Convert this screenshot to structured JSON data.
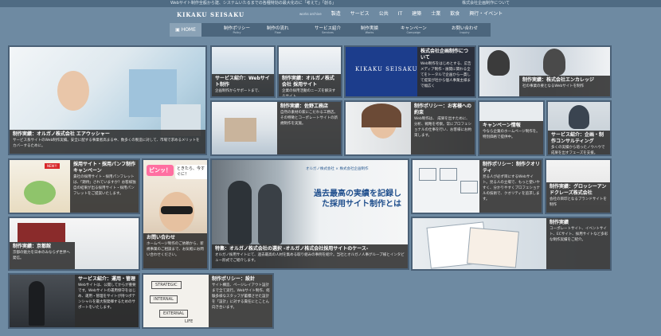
{
  "topbar": {
    "tagline": "Webサイト制作全般から建、システムいたるまでの各種特効の最大化のに「考えて」「創る」",
    "right": "株式会社企画制作について"
  },
  "logo": "KIKAKU SEISAKU",
  "topnav": {
    "small": "works archive",
    "items": [
      "製造",
      "サービス",
      "公共",
      "IT",
      "建築",
      "士業",
      "飲食",
      "興行・イベント"
    ]
  },
  "subnav": {
    "home": "HOME",
    "items": [
      {
        "label": "制作ポリシー",
        "sub": "Policy"
      },
      {
        "label": "制作の流れ",
        "sub": "Flow"
      },
      {
        "label": "サービス紹介",
        "sub": "Services"
      },
      {
        "label": "制作実績",
        "sub": "Works"
      },
      {
        "label": "キャンペーン",
        "sub": "Campaign"
      },
      {
        "label": "お問い合わせ",
        "sub": "Inquiry"
      }
    ]
  },
  "tiles": {
    "t1": {
      "title": "制作実績：オルガノ株式会社 エアウッシャー",
      "desc": "サービス系サイトのWeb制作実績。安全に配する事業者高まる中、数多くの製造に対して、市場で求めるメリットをカバーするために。"
    },
    "t2": {
      "title": "サービス紹介：Webサイト制作",
      "desc": "企画制作からサポートまで、"
    },
    "t3": {
      "title": "制作実績：オルガノ株式会社 採用サイト",
      "desc": "企業の採用活動のニーズを解決するサイト"
    },
    "t4": {
      "logo": "KIKAKU SEISAKU",
      "title": "株式会社企画制作について",
      "desc": "Web制作をはじめとする、広告メディア制作・展開に関わる全てをトータルで企画から一貫して提案が社から個人事業主様まで幅広く"
    },
    "t5": {
      "title": "制作実績：株式会社エンカレッジ",
      "desc": "社の事業の要となるWebサイトを制作"
    },
    "t6": {
      "title": "制作実績：佐野工務店",
      "desc": "自然の素材の家にこだわる工務店。その特徴とコーポレートサイトの新規制作を実施。"
    },
    "t7": {
      "title": "制作ポリシー：お客様への約束",
      "desc": "Web制作は、 成果を出すために、 分析、戦略を考察。常にプロフェショナルの仕事を行い、お客様にお約束します。"
    },
    "t8": {
      "title": "キャンペーン情報",
      "desc": "今なら企業のホームページ制作を。特別価格で提供中。"
    },
    "t9": {
      "title": "サービス紹介：企画・制作コンサルティング",
      "desc": "多くの実績から培ったノウハウで成果を出すフェーズを支援。"
    },
    "t10": {
      "badge": "NEW!!",
      "title": "採用サイト・採用パンフ制作キャンペーン",
      "desc": "貴社の採用サイト・採用パンフレットは、「期待」されていますか？お客様独自の結果が出る採用サイト・採用パンフレットをご提案いたします。"
    },
    "t11": {
      "bubble1": "ピンッ！",
      "bubble2": "ときたら、今すぐに！",
      "title": "お問い合わせ",
      "desc": "ホームページ制作のご依頼から、新規事業のご相談まで、お気軽にお問い合わせください。"
    },
    "t12": {
      "head": "過去最高の実績を記録した採用サイト制作とは",
      "brand1": "オルガノ株式会社",
      "brand2": "株式会社企画制作",
      "title": "特集：オルガノ株式会社の選択 -オルガノ株式会社採用サイトのケース-",
      "desc": "オルガノ採用サイトにて、過去最高の人材を集める取り組みの事例を紹介。当社とオルガノ人事グループ様とインタビュー形式でご紹介します。"
    },
    "t13": {
      "title": "制作ポリシー：制作クオリティ",
      "desc": "見る人が必ず目にするWebサイト。見る人の立場で、もっと使いやすく、分かりやすくプロフェショナルの技術で、クオリティを追求します。"
    },
    "t14": {
      "title": "制作実績：グロッシーアンドクレーズ株式会社",
      "desc": "会社の目印となるブランドサイトを制作"
    },
    "t15": {
      "title": "制作実績：京都館",
      "desc": "京都の魅力を日本のみならず世界へ発信。"
    },
    "t16": {
      "title": "制作実績",
      "desc": "コーポレートサイト、イベントサイト、ECサイト、採用サイトなど多彩な制作実績をご紹介。"
    },
    "t17": {
      "title": "サービス紹介：運用・管理",
      "desc": "Webサイトは、公開してからが重要です。Webサイトの運用保守をはじめ、運用・管理をサイトが持つポテンシャルを最大限発揮するためのサポートをいたします。"
    },
    "t18": {
      "words": [
        "STRATEGIC",
        "INTERNAL",
        "EXTERNAL",
        "LIFE"
      ],
      "title": "制作ポリシー：設計",
      "desc": "サイト構造、ページレイアウト設計まで全て実行。Webサイト制作、経験多様なスタッフが蓄積させた設計を「設計」に対する責任にとことん向き合います。"
    }
  },
  "colors": {
    "bg": "#6e8aa2",
    "nav": "#4c667d",
    "caption": "#2d2d2d",
    "blue": "#1c3d8c"
  }
}
